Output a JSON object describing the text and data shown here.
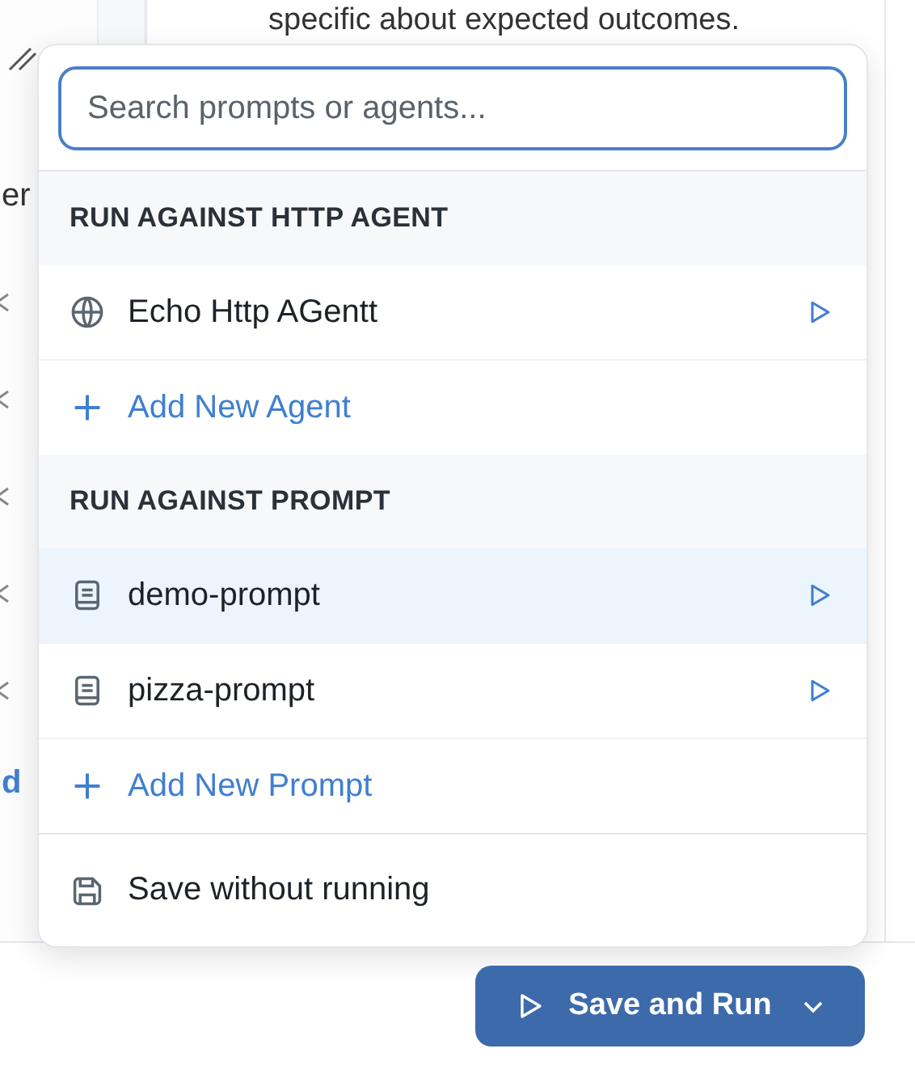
{
  "background": {
    "card_text": "specific about expected outcomes.",
    "side_fragment": "er",
    "side_link_fragment": "d"
  },
  "menu": {
    "search": {
      "placeholder": "Search prompts or agents..."
    },
    "sections": [
      {
        "title": "RUN AGAINST HTTP AGENT",
        "items": [
          {
            "kind": "agent",
            "label": "Echo Http AGentt",
            "selected": false
          }
        ],
        "add_label": "Add New Agent"
      },
      {
        "title": "RUN AGAINST PROMPT",
        "items": [
          {
            "kind": "prompt",
            "label": "demo-prompt",
            "selected": true
          },
          {
            "kind": "prompt",
            "label": "pizza-prompt",
            "selected": false
          }
        ],
        "add_label": "Add New Prompt"
      }
    ],
    "footer_action": "Save without running"
  },
  "run_button": {
    "label": "Save and Run"
  }
}
